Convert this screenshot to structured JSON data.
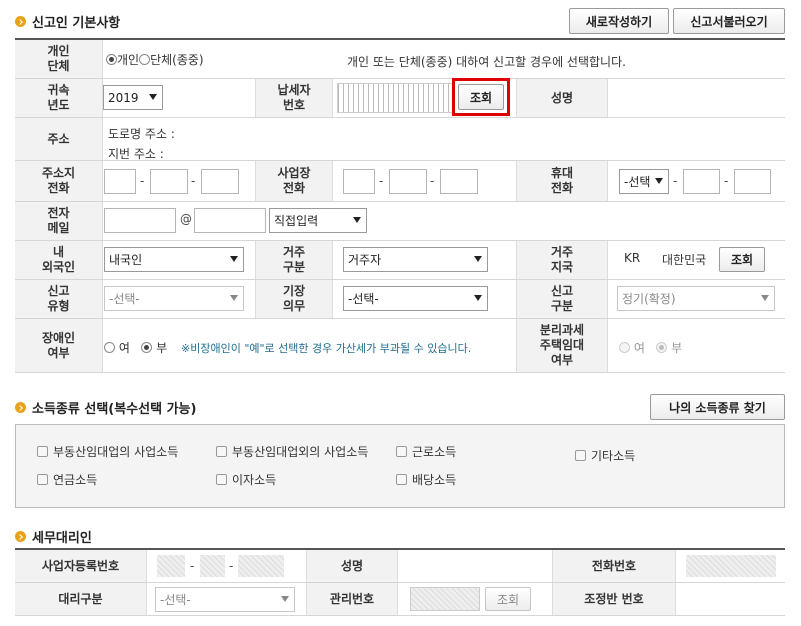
{
  "sections": {
    "basic_title": "신고인 기본사항",
    "income_title": "소득종류 선택(복수선택 가능)",
    "agent_title": "세무대리인"
  },
  "top_buttons": {
    "new": "새로작성하기",
    "load": "신고서불러오기"
  },
  "income_button": "나의 소득종류 찾기",
  "labels": {
    "person_type": "개인\n단체",
    "tax_year": "귀속\n년도",
    "taxpayer_no": "납세자\n번호",
    "name": "성명",
    "address": "주소",
    "home_phone": "주소지\n전화",
    "biz_phone": "사업장\n전화",
    "mobile": "휴대\n전화",
    "email": "전자\n메일",
    "nationality": "내\n외국인",
    "residence": "거주\n구분",
    "res_country": "거주\n지국",
    "report_type": "신고\n유형",
    "bookkeeping": "기장\n의무",
    "report_kind": "신고\n구분",
    "disabled": "장애인\n여부",
    "separate_tax": "분리과세\n주택임대\n여부"
  },
  "person_type": {
    "opt1": "개인",
    "opt2": "단체(종중)",
    "desc": "개인 또는 단체(종중) 대하여 신고할 경우에 선택합니다."
  },
  "tax_year": "2019",
  "lookup": "조회",
  "address": {
    "road": "도로명 주소 :",
    "lot": "지번 주소 :"
  },
  "mobile_select": "-선택",
  "email": {
    "at": "@",
    "direct": "직접입력"
  },
  "nationality_value": "내국인",
  "residence_value": "거주자",
  "country": {
    "code": "KR",
    "name": "대한민국"
  },
  "report_type_value": "-선택-",
  "bookkeeping_value": "-선택-",
  "report_kind_value": "정기(확정)",
  "disabled": {
    "yes": "여",
    "no": "부",
    "note": "※비장애인이 \"예\"로 선택한 경우 가산세가 부과될 수 있습니다."
  },
  "separate": {
    "yes": "여",
    "no": "부"
  },
  "income_types": [
    "부동산임대업의 사업소득",
    "부동산임대업외의 사업소득",
    "근로소득",
    "기타소득",
    "연금소득",
    "이자소득",
    "배당소득"
  ],
  "agent": {
    "biz_reg_no": "사업자등록번호",
    "name": "성명",
    "phone": "전화번호",
    "agent_type": "대리구분",
    "agent_type_value": "-선택-",
    "mgmt_no": "관리번호",
    "lookup": "조회",
    "adjust_no": "조정반 번호"
  },
  "accent_colors": {
    "bullet": "#e8a21a",
    "highlight_box": "#e00000",
    "note_text": "#1f6e8c"
  }
}
